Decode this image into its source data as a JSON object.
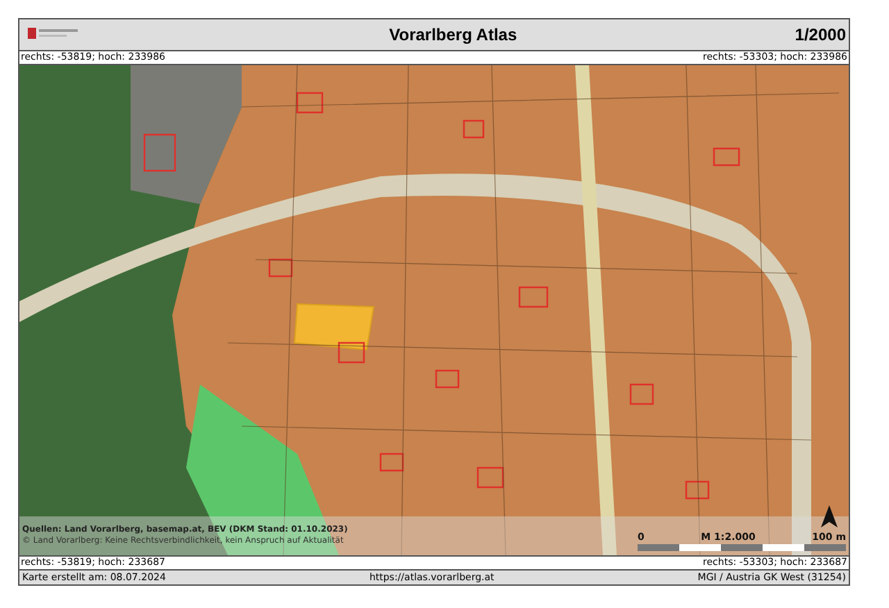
{
  "header": {
    "title": "Vorarlberg Atlas",
    "scale": "1/2000"
  },
  "coords_top": {
    "left": "rechts: -53819; hoch: 233986",
    "right": "rechts: -53303; hoch: 233986"
  },
  "map": {
    "sources": "Quellen: Land Vorarlberg, basemap.at, BEV (DKM Stand: 01.10.2023)",
    "disclaimer": "© Land Vorarlberg: Keine Rechtsverbindlichkeit, kein Anspruch auf Aktualität",
    "scale_bar": {
      "start": "0",
      "ratio": "M 1:2.000",
      "end": "100 m"
    }
  },
  "coords_bottom": {
    "left": "rechts: -53819; hoch: 233687",
    "right": "rechts: -53303; hoch: 233687"
  },
  "footer": {
    "created": "Karte erstellt am: 08.07.2024",
    "url": "https://atlas.vorarlberg.at",
    "crs": "MGI / Austria GK West (31254)"
  }
}
